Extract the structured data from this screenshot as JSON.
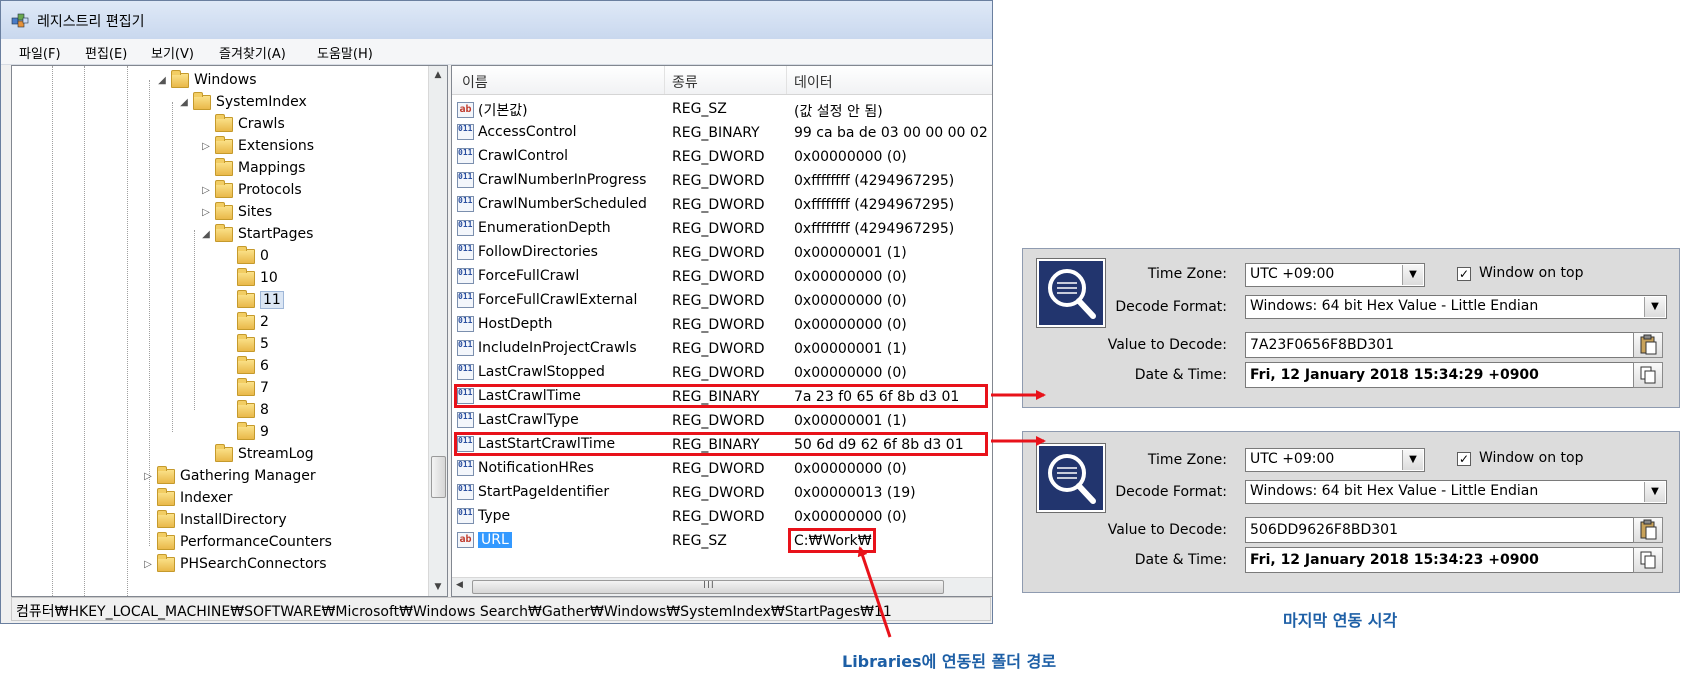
{
  "window": {
    "title": "레지스트리 편집기",
    "menu": [
      "파일(F)",
      "편집(E)",
      "보기(V)",
      "즐겨찾기(A)",
      "도움말(H)"
    ]
  },
  "tree": {
    "items": [
      {
        "label": "Windows",
        "expander": "◢"
      },
      {
        "label": "SystemIndex",
        "expander": "◢"
      },
      {
        "label": "Crawls",
        "expander": ""
      },
      {
        "label": "Extensions",
        "expander": "▷"
      },
      {
        "label": "Mappings",
        "expander": ""
      },
      {
        "label": "Protocols",
        "expander": "▷"
      },
      {
        "label": "Sites",
        "expander": "▷"
      },
      {
        "label": "StartPages",
        "expander": "◢"
      },
      {
        "label": "0",
        "expander": ""
      },
      {
        "label": "10",
        "expander": ""
      },
      {
        "label": "11",
        "expander": "",
        "selected": true
      },
      {
        "label": "2",
        "expander": ""
      },
      {
        "label": "5",
        "expander": ""
      },
      {
        "label": "6",
        "expander": ""
      },
      {
        "label": "7",
        "expander": ""
      },
      {
        "label": "8",
        "expander": ""
      },
      {
        "label": "9",
        "expander": ""
      },
      {
        "label": "StreamLog",
        "expander": ""
      },
      {
        "label": "Gathering Manager",
        "expander": "▷"
      },
      {
        "label": "Indexer",
        "expander": ""
      },
      {
        "label": "InstallDirectory",
        "expander": ""
      },
      {
        "label": "PerformanceCounters",
        "expander": ""
      },
      {
        "label": "PHSearchConnectors",
        "expander": "▷"
      }
    ]
  },
  "list": {
    "headers": [
      "이름",
      "종류",
      "데이터"
    ],
    "rows": [
      {
        "icon": "string-value-icon",
        "name": "(기본값)",
        "type": "REG_SZ",
        "data": "(값 설정 안 됨)"
      },
      {
        "icon": "binary-value-icon",
        "name": "AccessControl",
        "type": "REG_BINARY",
        "data": "99 ca ba de 03 00 00 00 02"
      },
      {
        "icon": "binary-value-icon",
        "name": "CrawlControl",
        "type": "REG_DWORD",
        "data": "0x00000000 (0)"
      },
      {
        "icon": "binary-value-icon",
        "name": "CrawlNumberInProgress",
        "type": "REG_DWORD",
        "data": "0xffffffff (4294967295)"
      },
      {
        "icon": "binary-value-icon",
        "name": "CrawlNumberScheduled",
        "type": "REG_DWORD",
        "data": "0xffffffff (4294967295)"
      },
      {
        "icon": "binary-value-icon",
        "name": "EnumerationDepth",
        "type": "REG_DWORD",
        "data": "0xffffffff (4294967295)"
      },
      {
        "icon": "binary-value-icon",
        "name": "FollowDirectories",
        "type": "REG_DWORD",
        "data": "0x00000001 (1)"
      },
      {
        "icon": "binary-value-icon",
        "name": "ForceFullCrawl",
        "type": "REG_DWORD",
        "data": "0x00000000 (0)"
      },
      {
        "icon": "binary-value-icon",
        "name": "ForceFullCrawlExternal",
        "type": "REG_DWORD",
        "data": "0x00000000 (0)"
      },
      {
        "icon": "binary-value-icon",
        "name": "HostDepth",
        "type": "REG_DWORD",
        "data": "0x00000000 (0)"
      },
      {
        "icon": "binary-value-icon",
        "name": "IncludeInProjectCrawls",
        "type": "REG_DWORD",
        "data": "0x00000001 (1)"
      },
      {
        "icon": "binary-value-icon",
        "name": "LastCrawlStopped",
        "type": "REG_DWORD",
        "data": "0x00000000 (0)"
      },
      {
        "icon": "binary-value-icon",
        "name": "LastCrawlTime",
        "type": "REG_BINARY",
        "data": "7a 23 f0 65 6f 8b d3 01",
        "highlight": true
      },
      {
        "icon": "binary-value-icon",
        "name": "LastCrawlType",
        "type": "REG_DWORD",
        "data": "0x00000001 (1)"
      },
      {
        "icon": "binary-value-icon",
        "name": "LastStartCrawlTime",
        "type": "REG_BINARY",
        "data": "50 6d d9 62 6f 8b d3 01",
        "highlight": true
      },
      {
        "icon": "binary-value-icon",
        "name": "NotificationHRes",
        "type": "REG_DWORD",
        "data": "0x00000000 (0)"
      },
      {
        "icon": "binary-value-icon",
        "name": "StartPageIdentifier",
        "type": "REG_DWORD",
        "data": "0x00000013 (19)"
      },
      {
        "icon": "binary-value-icon",
        "name": "Type",
        "type": "REG_DWORD",
        "data": "0x00000000 (0)"
      },
      {
        "icon": "string-value-icon",
        "name": "URL",
        "type": "REG_SZ",
        "data": "C:₩Work₩",
        "selected": true,
        "data_highlight": true
      }
    ]
  },
  "statusbar": "컴퓨터₩HKEY_LOCAL_MACHINE₩SOFTWARE₩Microsoft₩Windows Search₩Gather₩Windows₩SystemIndex₩StartPages₩11",
  "decoders": [
    {
      "tz_label": "Time Zone:",
      "tz_value": "UTC +09:00",
      "window_on_top_label": "Window on top",
      "window_on_top_checked": true,
      "format_label": "Decode Format:",
      "format_value": "Windows: 64 bit Hex Value - Little Endian",
      "value_label": "Value to Decode:",
      "value": "7A23F0656F8BD301",
      "datetime_label": "Date & Time:",
      "datetime": "Fri, 12 January 2018 15:34:29  +0900"
    },
    {
      "tz_label": "Time Zone:",
      "tz_value": "UTC +09:00",
      "window_on_top_label": "Window on top",
      "window_on_top_checked": true,
      "format_label": "Decode Format:",
      "format_value": "Windows: 64 bit Hex Value - Little Endian",
      "value_label": "Value to Decode:",
      "value": "506DD9626F8BD301",
      "datetime_label": "Date & Time:",
      "datetime": "Fri, 12 January 2018 15:34:23  +0900"
    }
  ],
  "captions": {
    "last_sync": "마지막 연동 시각",
    "folder_path": "Libraries에 연동된 폴더 경로"
  },
  "colors": {
    "highlight_red": "#e8121a",
    "caption_blue": "#1d5fa6",
    "selection_blue": "#3399ff"
  }
}
